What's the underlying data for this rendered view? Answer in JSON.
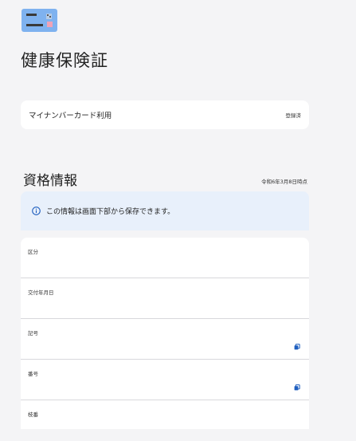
{
  "header": {
    "icon": "id-card-icon",
    "title": "健康保険証"
  },
  "mynumber": {
    "label": "マイナンバーカード利用",
    "status": "登録済"
  },
  "qualification": {
    "title": "資格情報",
    "as_of": "令和6年3月8日時点",
    "notice": "この情報は画面下部から保存できます。",
    "notice_icon": "info-icon",
    "fields": [
      {
        "label": "区分",
        "value": "",
        "copyable": false
      },
      {
        "label": "交付年月日",
        "value": "",
        "copyable": false
      },
      {
        "label": "記号",
        "value": "",
        "copyable": true
      },
      {
        "label": "番号",
        "value": "",
        "copyable": true
      },
      {
        "label": "枝番",
        "value": "",
        "copyable": false
      }
    ]
  },
  "colors": {
    "background": "#f4f4f6",
    "card_icon_blue": "#7fb2ef",
    "card_icon_pink": "#f0a3b7",
    "info_banner": "#e8f0fb",
    "accent_blue": "#1f5fbf"
  }
}
